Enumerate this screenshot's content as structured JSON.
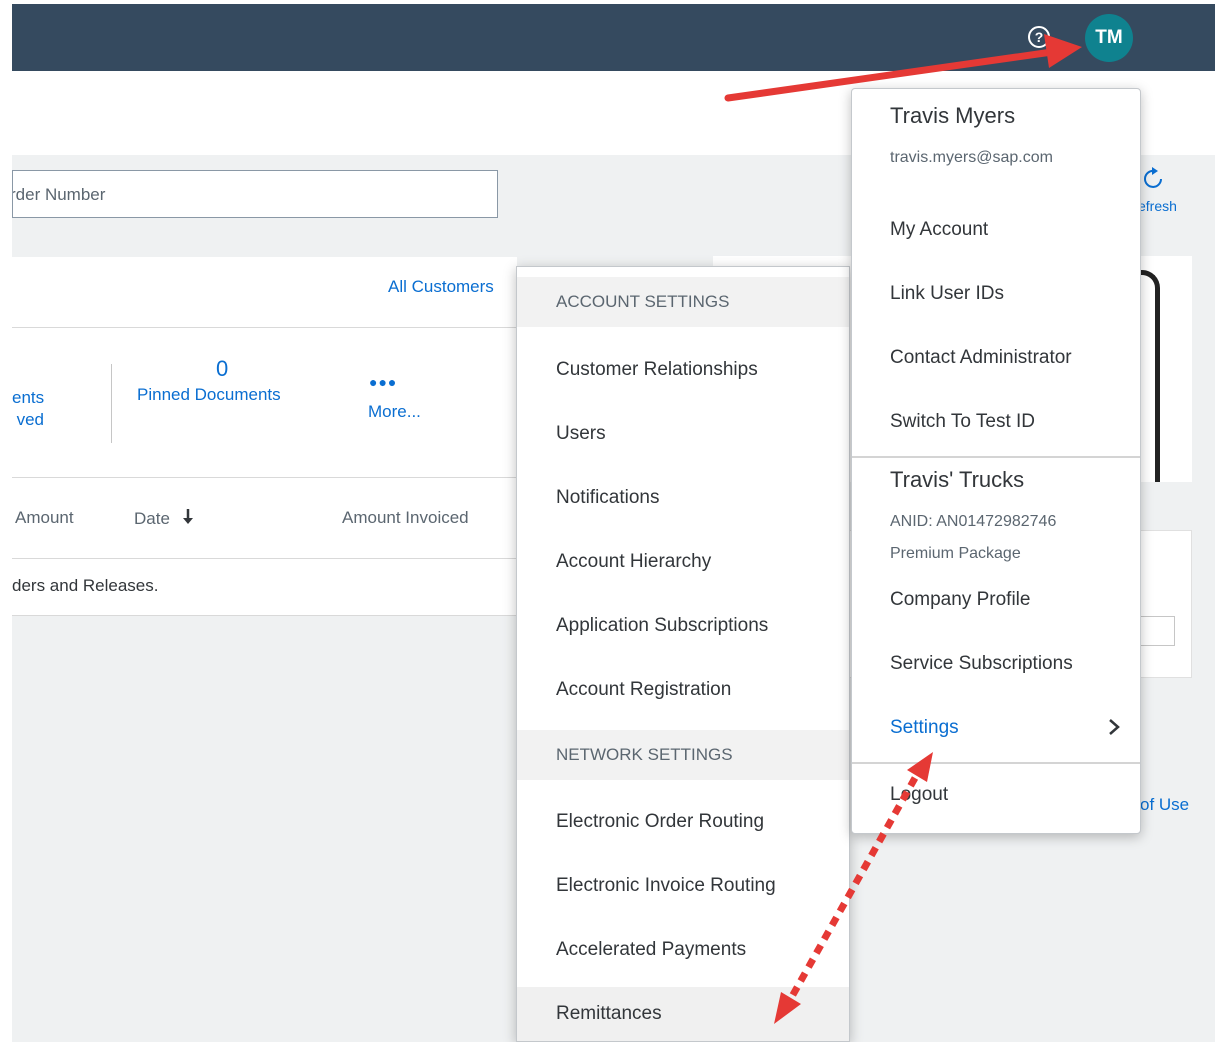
{
  "header": {
    "help_icon": "question-circle-icon",
    "avatar_initials": "TM"
  },
  "search": {
    "value": "rder Number"
  },
  "main_card": {
    "all_customers_link": "All Customers",
    "tiles": {
      "left_line1": "ents",
      "left_line2": "ved",
      "pinned_count": "0",
      "pinned_label": "Pinned Documents",
      "more_icon": "more-dots-icon",
      "more_label": "More..."
    },
    "table_headers": [
      "Amount",
      "Date",
      "Amount Invoiced"
    ],
    "date_sort_icon": "arrow-down-icon",
    "empty_message": "ders and Releases."
  },
  "right_panel": {
    "refresh_label": "efresh",
    "terms_link": "of Use"
  },
  "submenu": {
    "account_settings_header": "ACCOUNT SETTINGS",
    "account_items": [
      "Customer Relationships",
      "Users",
      "Notifications",
      "Account Hierarchy",
      "Application Subscriptions",
      "Account Registration"
    ],
    "network_settings_header": "NETWORK SETTINGS",
    "network_items": [
      "Electronic Order Routing",
      "Electronic Invoice Routing",
      "Accelerated Payments",
      "Remittances"
    ]
  },
  "user_menu": {
    "user_name": "Travis Myers",
    "user_email": "travis.myers@sap.com",
    "items": [
      "My Account",
      "Link User IDs",
      "Contact Administrator",
      "Switch To Test ID"
    ],
    "company_name": "Travis' Trucks",
    "anid": "ANID: AN01472982746",
    "package": "Premium Package",
    "company_items": [
      "Company Profile",
      "Service Subscriptions"
    ],
    "settings_label": "Settings",
    "logout_label": "Logout"
  },
  "colors": {
    "header_bg": "#354a5f",
    "avatar_bg": "#0f828f",
    "link_blue": "#0a6ed1",
    "annotation_red": "#e53935"
  }
}
